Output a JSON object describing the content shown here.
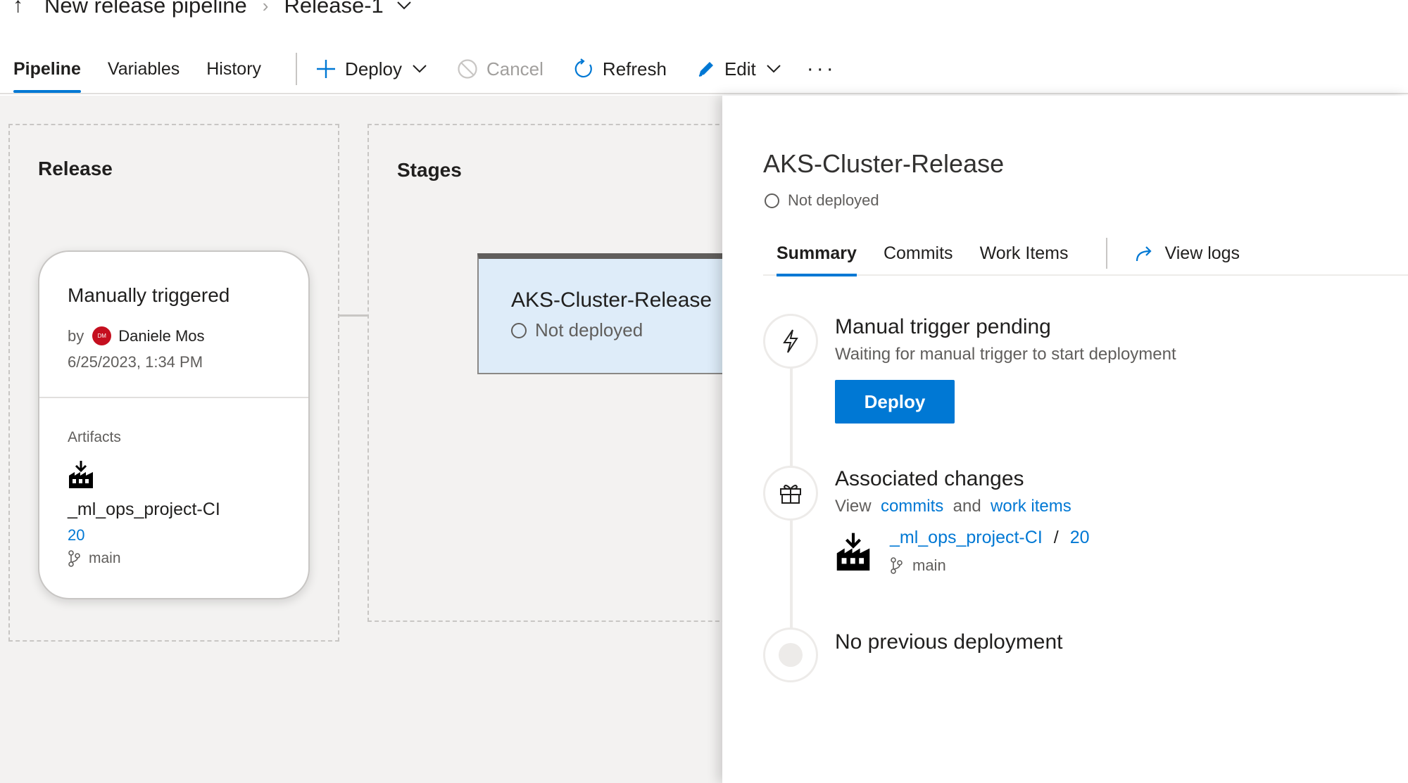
{
  "breadcrumb": {
    "pipeline": "New release pipeline",
    "release": "Release-1"
  },
  "tabs": [
    {
      "label": "Pipeline",
      "active": true
    },
    {
      "label": "Variables",
      "active": false
    },
    {
      "label": "History",
      "active": false
    }
  ],
  "toolbar": {
    "deploy": "Deploy",
    "cancel": "Cancel",
    "refresh": "Refresh",
    "edit": "Edit",
    "more": "···"
  },
  "canvas": {
    "release_title": "Release",
    "stages_title": "Stages",
    "release_card": {
      "trigger": "Manually triggered",
      "by_label": "by",
      "avatar_initials": "DM",
      "user": "Daniele Mos",
      "date": "6/25/2023, 1:34 PM",
      "artifacts_label": "Artifacts",
      "artifact_name": "_ml_ops_project-CI",
      "artifact_version": "20",
      "branch": "main"
    },
    "stage": {
      "name": "AKS-Cluster-Release",
      "status": "Not deployed"
    }
  },
  "pane": {
    "title": "AKS-Cluster-Release",
    "status": "Not deployed",
    "tabs": [
      "Summary",
      "Commits",
      "Work Items"
    ],
    "view_logs": "View logs",
    "manual": {
      "title": "Manual trigger pending",
      "subtitle": "Waiting for manual trigger to start deployment",
      "button": "Deploy"
    },
    "changes": {
      "title": "Associated changes",
      "view": "View",
      "commits": "commits",
      "and": "and",
      "work_items": "work items",
      "artifact_name": "_ml_ops_project-CI",
      "slash": "/",
      "version": "20",
      "branch": "main"
    },
    "previous": "No previous deployment"
  },
  "colors": {
    "accent": "#0078d4",
    "stage_bg": "#deecf9",
    "avatar": "#c50f1f"
  }
}
